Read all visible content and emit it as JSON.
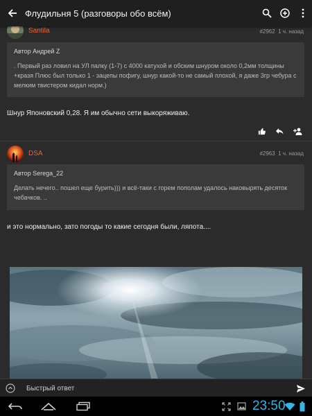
{
  "app_bar": {
    "title": "Флудильня 5 (разговоры обо всём)",
    "icons": [
      "back-arrow-icon",
      "search-icon",
      "add-circle-icon",
      "more-vert-icon"
    ]
  },
  "posts": [
    {
      "author": "Santila",
      "number": "#2962",
      "time": "1 ч. назад",
      "quote_author": "Автор Андрей Z",
      "quote_text": ". Первый раз ловил на УЛ палку (1-7) с 4000 катухой и обским шнуром около 0,2мм толщины +кразя Плюс был только 1 - зацепы пофигу, шнур какой-то не самый плохой, я даже 3гр чебура с мелким твистером кидал норм.)",
      "text": "Шнур Японовский 0,28. Я им обычно сети выкоряживаю.",
      "actions": [
        "like-icon",
        "reply-icon",
        "add-person-icon"
      ]
    },
    {
      "author": "DSA",
      "number": "#2963",
      "time": "1 ч. назад",
      "quote_author": "Автор Serega_22",
      "quote_text": "Делать нечего.. пошел еще бурить))) и всё-таки с горем пополам удалось наковырять десяток чебачков. ..",
      "text": "и это нормально, зато погоды то какие сегодня были, ляпота....",
      "image": "sky-with-clouds-and-sun"
    }
  ],
  "reply_bar": {
    "placeholder": "Быстрый ответ"
  },
  "system_bar": {
    "time": "23:50",
    "icons": [
      "back-icon",
      "home-icon",
      "recent-apps-icon",
      "fullscreen-icon",
      "gallery-icon",
      "wifi-icon",
      "battery-icon"
    ]
  },
  "colors": {
    "accent": "#e8673a",
    "clock": "#33b5e5",
    "background": "#2b2b2b",
    "quote_background": "#3a3a3a"
  }
}
